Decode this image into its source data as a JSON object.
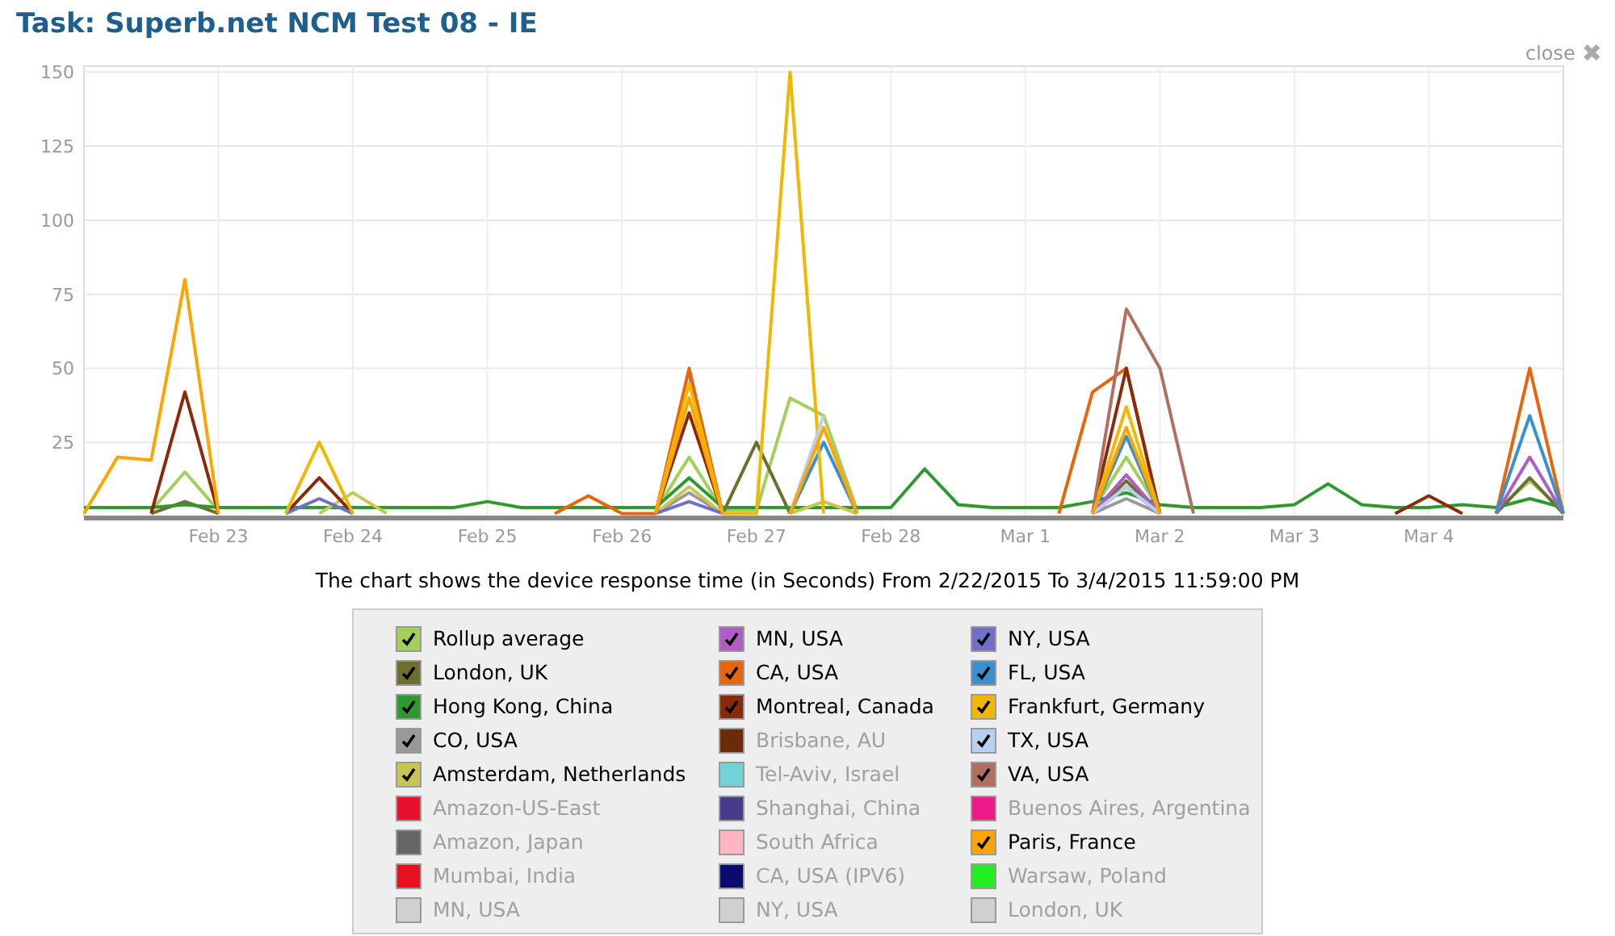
{
  "title": "Task: Superb.net NCM Test 08 - IE",
  "close": {
    "label": "close",
    "icon": "✖"
  },
  "chart_data": {
    "type": "line",
    "ylim": [
      0,
      152
    ],
    "grid": true,
    "yticks": [
      25,
      50,
      75,
      100,
      125,
      150
    ],
    "categories": [
      null,
      null,
      null,
      null,
      "Feb 23",
      null,
      null,
      null,
      "Feb 24",
      null,
      null,
      null,
      "Feb 25",
      null,
      null,
      null,
      "Feb 26",
      null,
      null,
      null,
      "Feb 27",
      null,
      null,
      null,
      "Feb 28",
      null,
      null,
      null,
      "Mar 1",
      null,
      null,
      null,
      "Mar 2",
      null,
      null,
      null,
      "Mar 3",
      null,
      null,
      null,
      "Mar 4",
      null,
      null,
      null,
      null
    ],
    "series": [
      {
        "color": "#a2d05a",
        "values": [
          null,
          null,
          2,
          15,
          2,
          null,
          null,
          null,
          null,
          null,
          null,
          null,
          null,
          null,
          null,
          null,
          null,
          2,
          20,
          2,
          2,
          40,
          34,
          2,
          null,
          null,
          null,
          null,
          null,
          null,
          2,
          20,
          2,
          null,
          null,
          null,
          null,
          null,
          null,
          null,
          null,
          null,
          2,
          12,
          2
        ]
      },
      {
        "color": "#6e6e30",
        "values": [
          null,
          null,
          1,
          5,
          1,
          null,
          null,
          null,
          null,
          null,
          null,
          null,
          null,
          null,
          null,
          null,
          null,
          null,
          null,
          1,
          25,
          1,
          null,
          null,
          null,
          null,
          null,
          null,
          null,
          null,
          1,
          12,
          1,
          null,
          null,
          null,
          null,
          null,
          null,
          null,
          null,
          null,
          1,
          13,
          1
        ]
      },
      {
        "color": "#2e9a2e",
        "values": [
          3,
          3,
          3,
          4,
          3,
          3,
          3,
          3,
          3,
          3,
          3,
          3,
          5,
          3,
          3,
          3,
          3,
          3,
          13,
          3,
          3,
          3,
          3,
          3,
          3,
          16,
          4,
          3,
          3,
          3,
          5,
          8,
          4,
          3,
          3,
          3,
          4,
          11,
          4,
          3,
          3,
          4,
          3,
          6,
          3
        ]
      },
      {
        "color": "#999999",
        "values": [
          null,
          null,
          null,
          null,
          null,
          null,
          null,
          null,
          null,
          null,
          null,
          null,
          null,
          null,
          null,
          null,
          null,
          1,
          8,
          1,
          null,
          null,
          null,
          null,
          null,
          null,
          null,
          null,
          null,
          null,
          1,
          6,
          1,
          null,
          null,
          null,
          null,
          null,
          null,
          null,
          null,
          null,
          null,
          null,
          null
        ]
      },
      {
        "color": "#c6c650",
        "values": [
          null,
          null,
          null,
          null,
          null,
          null,
          null,
          1,
          8,
          1,
          null,
          null,
          null,
          null,
          null,
          null,
          null,
          1,
          10,
          1,
          null,
          1,
          5,
          1,
          null,
          null,
          null,
          null,
          null,
          null,
          1,
          10,
          1,
          null,
          null,
          null,
          null,
          null,
          null,
          null,
          null,
          null,
          null,
          null,
          null
        ]
      },
      {
        "color": "#b05cc6",
        "values": [
          null,
          null,
          null,
          null,
          null,
          null,
          null,
          null,
          null,
          null,
          null,
          null,
          null,
          null,
          null,
          null,
          null,
          null,
          48,
          1,
          null,
          null,
          null,
          null,
          null,
          null,
          null,
          null,
          null,
          null,
          1,
          14,
          1,
          null,
          null,
          null,
          null,
          null,
          null,
          null,
          null,
          null,
          1,
          20,
          1
        ]
      },
      {
        "color": "#e8650c",
        "values": [
          null,
          null,
          null,
          null,
          null,
          null,
          null,
          null,
          null,
          null,
          null,
          null,
          null,
          null,
          1,
          7,
          1,
          1,
          50,
          1,
          null,
          null,
          null,
          null,
          null,
          null,
          null,
          null,
          null,
          1,
          42,
          50,
          1,
          null,
          null,
          null,
          null,
          null,
          null,
          null,
          null,
          null,
          1,
          50,
          1
        ]
      },
      {
        "color": "#8b2a0a",
        "values": [
          null,
          null,
          1,
          42,
          1,
          null,
          1,
          13,
          1,
          null,
          null,
          null,
          null,
          null,
          null,
          null,
          null,
          1,
          35,
          1,
          null,
          null,
          null,
          null,
          null,
          null,
          null,
          null,
          null,
          null,
          1,
          50,
          1,
          null,
          null,
          null,
          null,
          null,
          null,
          1,
          7,
          1,
          null,
          null,
          null
        ]
      },
      {
        "color": "#7070c8",
        "values": [
          null,
          null,
          null,
          null,
          null,
          null,
          1,
          6,
          1,
          null,
          null,
          null,
          null,
          null,
          null,
          null,
          null,
          1,
          5,
          1,
          null,
          null,
          null,
          null,
          null,
          null,
          null,
          null,
          null,
          null,
          1,
          10,
          1,
          null,
          null,
          null,
          null,
          null,
          null,
          null,
          null,
          null,
          null,
          null,
          null
        ]
      },
      {
        "color": "#3a8fd0",
        "values": [
          null,
          null,
          null,
          null,
          null,
          null,
          null,
          null,
          null,
          null,
          null,
          null,
          null,
          null,
          null,
          null,
          null,
          null,
          null,
          null,
          null,
          1,
          25,
          1,
          null,
          null,
          null,
          null,
          null,
          null,
          1,
          27,
          1,
          null,
          null,
          null,
          null,
          null,
          null,
          null,
          null,
          null,
          1,
          34,
          1
        ]
      },
      {
        "color": "#f0b800",
        "values": [
          null,
          null,
          null,
          null,
          null,
          null,
          1,
          25,
          1,
          null,
          null,
          null,
          null,
          null,
          null,
          null,
          null,
          1,
          45,
          1,
          1,
          150,
          1,
          null,
          null,
          null,
          null,
          null,
          null,
          null,
          1,
          37,
          1,
          null,
          null,
          null,
          null,
          null,
          null,
          null,
          null,
          null,
          null,
          null,
          null
        ]
      },
      {
        "color": "#b8d0f0",
        "values": [
          null,
          null,
          null,
          null,
          null,
          null,
          null,
          null,
          null,
          null,
          null,
          null,
          null,
          null,
          null,
          null,
          null,
          null,
          null,
          null,
          null,
          1,
          34,
          null,
          null,
          null,
          null,
          null,
          null,
          null,
          1,
          10,
          1,
          null,
          null,
          null,
          null,
          null,
          null,
          null,
          null,
          null,
          null,
          null,
          null
        ]
      },
      {
        "color": "#b07060",
        "values": [
          null,
          null,
          null,
          null,
          null,
          null,
          null,
          null,
          null,
          null,
          null,
          null,
          null,
          null,
          null,
          null,
          null,
          null,
          null,
          null,
          null,
          null,
          null,
          null,
          null,
          null,
          null,
          null,
          null,
          null,
          1,
          70,
          50,
          1,
          null,
          null,
          null,
          null,
          null,
          null,
          null,
          null,
          null,
          null,
          null
        ]
      },
      {
        "color": "#ffa500",
        "values": [
          1,
          20,
          19,
          80,
          1,
          null,
          null,
          null,
          null,
          null,
          null,
          null,
          null,
          null,
          null,
          null,
          null,
          1,
          40,
          1,
          null,
          1,
          30,
          1,
          null,
          null,
          null,
          null,
          null,
          null,
          1,
          30,
          1,
          null,
          null,
          null,
          null,
          null,
          null,
          null,
          null,
          null,
          null,
          null,
          null
        ]
      }
    ]
  },
  "caption": "The chart shows the device response time (in Seconds) From 2/22/2015 To 3/4/2015 11:59:00 PM",
  "legend": [
    {
      "label": "Rollup average",
      "color": "#a2d05a",
      "checked": true
    },
    {
      "label": "MN, USA",
      "color": "#b05cc6",
      "checked": true
    },
    {
      "label": "NY, USA",
      "color": "#7070c8",
      "checked": true
    },
    {
      "label": "London, UK",
      "color": "#6e6e30",
      "checked": true
    },
    {
      "label": "CA, USA",
      "color": "#e8650c",
      "checked": true
    },
    {
      "label": "FL, USA",
      "color": "#3a8fd0",
      "checked": true
    },
    {
      "label": "Hong Kong, China",
      "color": "#2e9a2e",
      "checked": true
    },
    {
      "label": "Montreal, Canada",
      "color": "#8b2a0a",
      "checked": true
    },
    {
      "label": "Frankfurt, Germany",
      "color": "#f0b800",
      "checked": true
    },
    {
      "label": "CO, USA",
      "color": "#999999",
      "checked": true
    },
    {
      "label": "Brisbane, AU",
      "color": "#6b2a0a",
      "checked": false
    },
    {
      "label": "TX, USA",
      "color": "#b8d0f0",
      "checked": true
    },
    {
      "label": "Amsterdam, Netherlands",
      "color": "#c6c650",
      "checked": true
    },
    {
      "label": "Tel-Aviv, Israel",
      "color": "#72d2d6",
      "checked": false
    },
    {
      "label": "VA, USA",
      "color": "#b07060",
      "checked": true
    },
    {
      "label": "Amazon-US-East",
      "color": "#e8102a",
      "checked": false
    },
    {
      "label": "Shanghai, China",
      "color": "#483a8c",
      "checked": false
    },
    {
      "label": "Buenos Aires, Argentina",
      "color": "#f01888",
      "checked": false
    },
    {
      "label": "Amazon, Japan",
      "color": "#666666",
      "checked": false
    },
    {
      "label": "South Africa",
      "color": "#ffb6c1",
      "checked": false
    },
    {
      "label": "Paris, France",
      "color": "#ffa500",
      "checked": true
    },
    {
      "label": "Mumbai, India",
      "color": "#e8101e",
      "checked": false
    },
    {
      "label": "CA, USA (IPV6)",
      "color": "#0a0a70",
      "checked": false
    },
    {
      "label": "Warsaw, Poland",
      "color": "#22ee22",
      "checked": false
    },
    {
      "label": "MN, USA",
      "color": "#d0d0d0",
      "checked": false
    },
    {
      "label": "NY, USA",
      "color": "#d0d0d0",
      "checked": false
    },
    {
      "label": "London, UK",
      "color": "#d0d0d0",
      "checked": false
    }
  ]
}
